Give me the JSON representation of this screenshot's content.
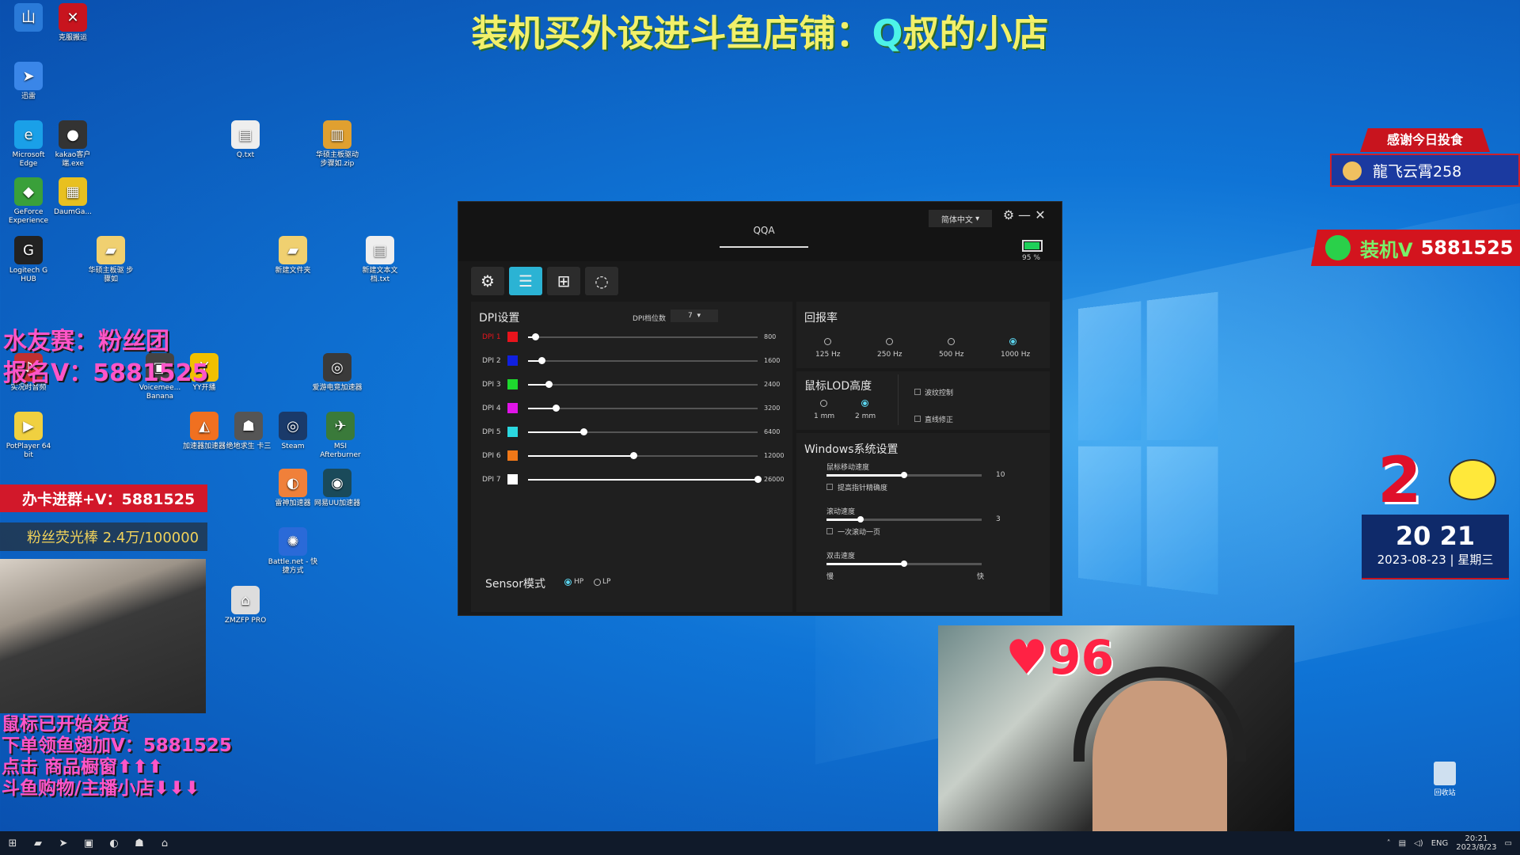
{
  "banner": {
    "prefix": "装机买外设进斗鱼店铺：",
    "q": "Q",
    "suffix": "叔的小店"
  },
  "desktop_icons": [
    {
      "name": "desktop-icon-shanmai",
      "label": "",
      "glyph": "山"
    },
    {
      "name": "desktop-icon-app2",
      "label": "克服搬运",
      "glyph": "✕"
    },
    {
      "name": "desktop-icon-xunlei",
      "label": "迅雷",
      "glyph": "➤"
    },
    {
      "name": "desktop-icon-edge",
      "label": "Microsoft Edge",
      "glyph": "e"
    },
    {
      "name": "desktop-icon-kakao",
      "label": "kakao客户端.exe",
      "glyph": "●"
    },
    {
      "name": "desktop-icon-geforce",
      "label": "GeForce Experience",
      "glyph": "◆"
    },
    {
      "name": "desktop-icon-daum",
      "label": "DaumGa...",
      "glyph": "▦"
    },
    {
      "name": "desktop-icon-logitech",
      "label": "Logitech G HUB",
      "glyph": "G"
    },
    {
      "name": "desktop-icon-voicemeeter",
      "label": "Voicemee... Banana",
      "glyph": "▣"
    },
    {
      "name": "desktop-icon-yy",
      "label": "YY开播",
      "glyph": "Y"
    },
    {
      "name": "desktop-icon-shibie",
      "label": "实况时音频",
      "glyph": "♪"
    },
    {
      "name": "desktop-icon-potplayer",
      "label": "PotPlayer 64 bit",
      "glyph": "▶"
    },
    {
      "name": "desktop-icon-steam",
      "label": "Steam",
      "glyph": "◎"
    },
    {
      "name": "desktop-icon-msi",
      "label": "MSI Afterburner",
      "glyph": "✈"
    },
    {
      "name": "desktop-icon-battlenet",
      "label": "Battle.net - 快捷方式",
      "glyph": "✺"
    },
    {
      "name": "desktop-icon-zmzfp",
      "label": "ZMZFP PRO",
      "glyph": "⌂"
    },
    {
      "name": "desktop-icon-txt",
      "label": "Q.txt",
      "glyph": "▤"
    },
    {
      "name": "desktop-icon-zip",
      "label": "华硕主板驱动 步骤如.zip",
      "glyph": "▥"
    },
    {
      "name": "desktop-icon-folder1",
      "label": "华硕主板驱 步骤如",
      "glyph": "▰"
    },
    {
      "name": "desktop-icon-folder2",
      "label": "新建文件夹",
      "glyph": "▰"
    },
    {
      "name": "desktop-icon-newtxt",
      "label": "新建文本文档.txt",
      "glyph": "▤"
    },
    {
      "name": "desktop-icon-booster",
      "label": "雷神加速器",
      "glyph": "◐"
    },
    {
      "name": "desktop-icon-uu",
      "label": "网易UU加速器",
      "glyph": "◉"
    },
    {
      "name": "desktop-icon-pubg",
      "label": "绝地求生 卡三",
      "glyph": "☗"
    },
    {
      "name": "desktop-icon-accel",
      "label": "加速器加速器",
      "glyph": "◭"
    },
    {
      "name": "desktop-icon-monitor",
      "label": "爱游电竞加速器",
      "glyph": "◎"
    }
  ],
  "left_overlay": {
    "line1": "水友赛：粉丝团",
    "line2": "报名V：5881525",
    "redbar": "办卡进群+V：5881525",
    "fanbar": "粉丝荧光棒  2.4万/100000",
    "promo": [
      "鼠标已开始发货",
      "下单领鱼翅加V：5881525",
      "点击 商品橱窗⬆⬆⬆",
      "斗鱼购物/主播小店⬇⬇⬇"
    ]
  },
  "app": {
    "logo": "QQA",
    "language": "简体中文",
    "battery_pct_text": "95 %",
    "battery_level": 0.95,
    "tabs": [
      {
        "name": "tab-settings",
        "icon": "⚙"
      },
      {
        "name": "tab-performance",
        "icon": "☰"
      },
      {
        "name": "tab-macro",
        "icon": "+"
      },
      {
        "name": "tab-lighting",
        "icon": "💡"
      }
    ],
    "dpi": {
      "title": "DPI设置",
      "levels_label": "DPI档位数",
      "levels_value": "7",
      "rows": [
        {
          "label": "DPI 1",
          "color": "#e8141c",
          "value": "800",
          "frac": 0.03
        },
        {
          "label": "DPI 2",
          "color": "#1020e0",
          "value": "1600",
          "frac": 0.06
        },
        {
          "label": "DPI 3",
          "color": "#1ed82e",
          "value": "2400",
          "frac": 0.09
        },
        {
          "label": "DPI 4",
          "color": "#e014e8",
          "value": "3200",
          "frac": 0.12
        },
        {
          "label": "DPI 5",
          "color": "#2bd8e0",
          "value": "6400",
          "frac": 0.24
        },
        {
          "label": "DPI 6",
          "color": "#f07818",
          "value": "12000",
          "frac": 0.46
        },
        {
          "label": "DPI 7",
          "color": "#ffffff",
          "value": "26000",
          "frac": 1.0
        }
      ],
      "sensor_label": "Sensor模式",
      "sensor_hp": "HP",
      "sensor_lp": "LP"
    },
    "polling": {
      "title": "回报率",
      "options": [
        "125 Hz",
        "250 Hz",
        "500 Hz",
        "1000 Hz"
      ],
      "selected": 3
    },
    "lod": {
      "title": "鼠标LOD高度",
      "options": [
        "1 mm",
        "2 mm"
      ],
      "selected": 1,
      "ripple": "波纹控制",
      "angle": "直线修正"
    },
    "windows": {
      "title": "Windows系统设置",
      "speed_label": "鼠标移动速度",
      "speed_value": "10",
      "speed_frac": 0.5,
      "precision": "提高指针精确度",
      "scroll_label": "滚动速度",
      "scroll_value": "3",
      "scroll_frac": 0.22,
      "scroll_page": "一次滚动一页",
      "dbl_label": "双击速度",
      "dbl_frac": 0.5,
      "dbl_slow": "慢",
      "dbl_fast": "快"
    }
  },
  "right_overlay": {
    "thanks": "感谢今日投食",
    "donor": "龍飞云霄258",
    "wechat": "装机V",
    "wechat_num": "5881525",
    "count": "2",
    "time": "20 21",
    "date": "2023-08-23 | 星期三",
    "hearts": "96"
  },
  "recycle_label": "回收站",
  "taskbar": {
    "lang": "ENG",
    "time": "20:21",
    "date": "2023/8/23"
  }
}
